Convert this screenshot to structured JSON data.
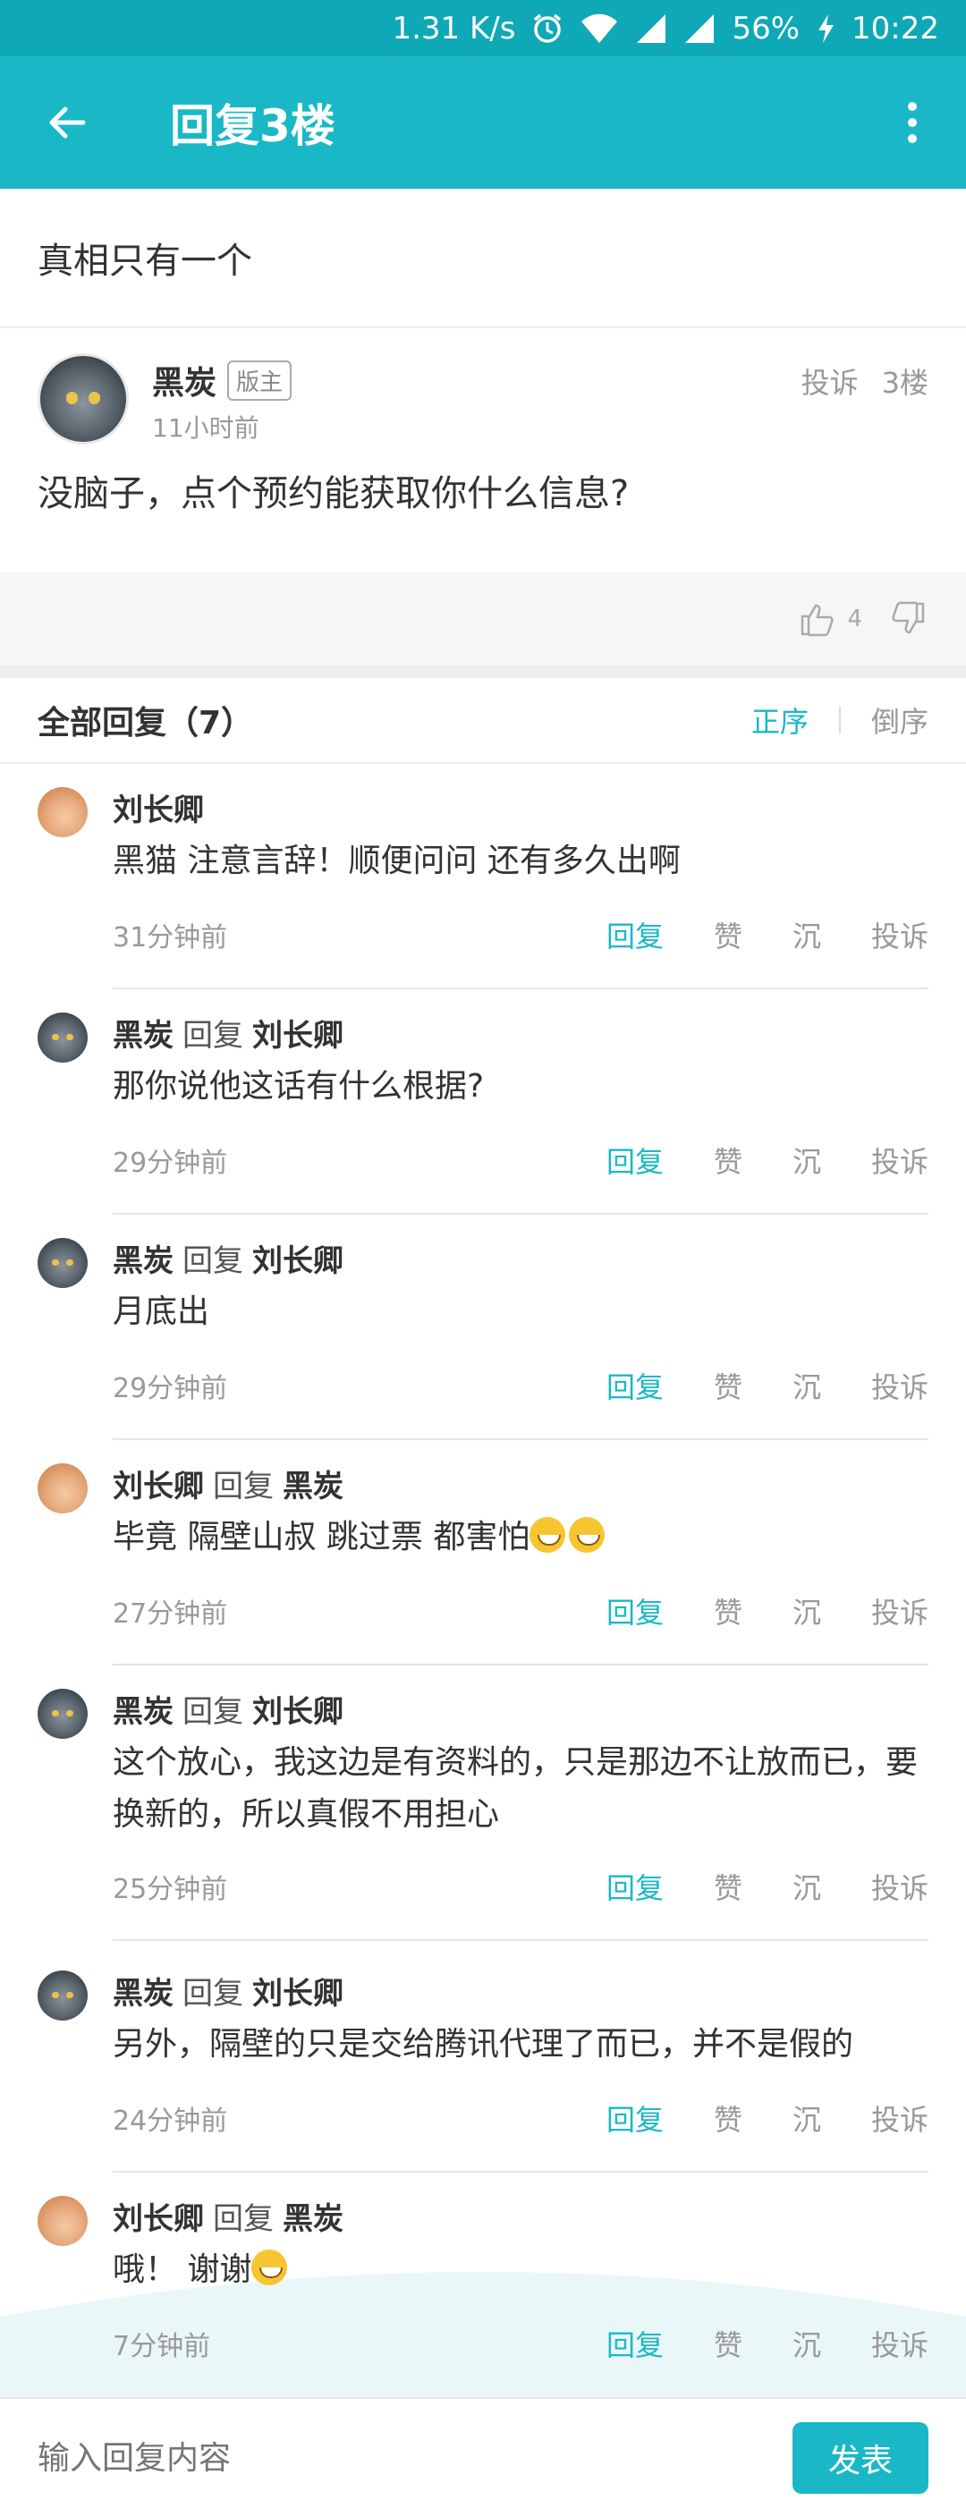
{
  "status": {
    "speed": "1.31 K/s",
    "battery": "56%",
    "time": "10:22"
  },
  "appbar": {
    "title": "回复3楼"
  },
  "post": {
    "title": "真相只有一个"
  },
  "floor": {
    "username": "黑炭",
    "badge": "版主",
    "time": "11小时前",
    "report": "投诉",
    "floor_no": "3楼",
    "content": "没脑子，点个预约能获取你什么信息?",
    "likes": "4"
  },
  "replies_header": {
    "label": "全部回复（7）",
    "asc": "正序",
    "desc": "倒序"
  },
  "reply_actions": {
    "reply": "回复",
    "like": "赞",
    "sink": "沉",
    "report": "投诉"
  },
  "replies": [
    {
      "user": "刘长卿",
      "reply_word": "",
      "target": "",
      "text": "黑猫 注意言辞！顺便问问 还有多久出啊",
      "time": "31分钟前",
      "avatar": "girl"
    },
    {
      "user": "黑炭",
      "reply_word": "回复",
      "target": "刘长卿",
      "text": "那你说他这话有什么根据?",
      "time": "29分钟前",
      "avatar": "cat"
    },
    {
      "user": "黑炭",
      "reply_word": "回复",
      "target": "刘长卿",
      "text": "月底出",
      "time": "29分钟前",
      "avatar": "cat"
    },
    {
      "user": "刘长卿",
      "reply_word": "回复",
      "target": "黑炭",
      "text": "毕竟 隔壁山叔 跳过票 都害怕",
      "time": "27分钟前",
      "avatar": "girl"
    },
    {
      "user": "黑炭",
      "reply_word": "回复",
      "target": "刘长卿",
      "text": "这个放心，我这边是有资料的，只是那边不让放而已，要换新的，所以真假不用担心",
      "time": "25分钟前",
      "avatar": "cat"
    },
    {
      "user": "黑炭",
      "reply_word": "回复",
      "target": "刘长卿",
      "text": "另外，隔壁的只是交给腾讯代理了而已，并不是假的",
      "time": "24分钟前",
      "avatar": "cat"
    },
    {
      "user": "刘长卿",
      "reply_word": "回复",
      "target": "黑炭",
      "text": "哦！ 谢谢",
      "time": "7分钟前",
      "avatar": "girl"
    }
  ],
  "input": {
    "placeholder": "输入回复内容",
    "send": "发表"
  },
  "colors": {
    "accent": "#1ab8c6",
    "statusbar": "#0fa8b6"
  }
}
